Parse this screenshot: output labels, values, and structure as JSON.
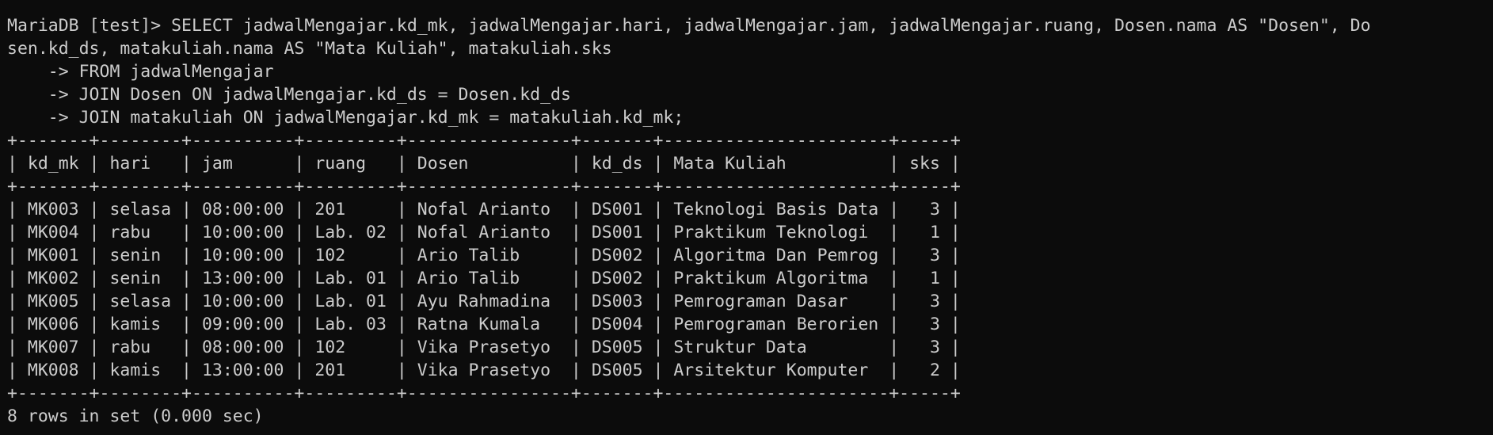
{
  "terminal": {
    "lines": [
      "                                            ",
      "MariaDB [test]> SELECT jadwalMengajar.kd_mk, jadwalMengajar.hari, jadwalMengajar.jam, jadwalMengajar.ruang, Dosen.nama AS \"Dosen\", Do",
      "sen.kd_ds, matakuliah.nama AS \"Mata Kuliah\", matakuliah.sks",
      "    -> FROM jadwalMengajar",
      "    -> JOIN Dosen ON jadwalMengajar.kd_ds = Dosen.kd_ds",
      "    -> JOIN matakuliah ON jadwalMengajar.kd_mk = matakuliah.kd_mk;",
      "+-------+--------+----------+---------+----------------+-------+----------------------+-----+",
      "| kd_mk | hari   | jam      | ruang   | Dosen          | kd_ds | Mata Kuliah          | sks |",
      "+-------+--------+----------+---------+----------------+-------+----------------------+-----+",
      "| MK003 | selasa | 08:00:00 | 201     | Nofal Arianto  | DS001 | Teknologi Basis Data |   3 |",
      "| MK004 | rabu   | 10:00:00 | Lab. 02 | Nofal Arianto  | DS001 | Praktikum Teknologi  |   1 |",
      "| MK001 | senin  | 10:00:00 | 102     | Ario Talib     | DS002 | Algoritma Dan Pemrog |   3 |",
      "| MK002 | senin  | 13:00:00 | Lab. 01 | Ario Talib     | DS002 | Praktikum Algoritma  |   1 |",
      "| MK005 | selasa | 10:00:00 | Lab. 01 | Ayu Rahmadina  | DS003 | Pemrograman Dasar    |   3 |",
      "| MK006 | kamis  | 09:00:00 | Lab. 03 | Ratna Kumala   | DS004 | Pemrograman Berorien |   3 |",
      "| MK007 | rabu   | 08:00:00 | 102     | Vika Prasetyo  | DS005 | Struktur Data        |   3 |",
      "| MK008 | kamis  | 13:00:00 | 201     | Vika Prasetyo  | DS005 | Arsitektur Komputer  |   2 |",
      "+-------+--------+----------+---------+----------------+-------+----------------------+-----+",
      "8 rows in set (0.000 sec)"
    ]
  },
  "colors": {
    "background": "#0c0c0c",
    "text": "#cccccc"
  }
}
